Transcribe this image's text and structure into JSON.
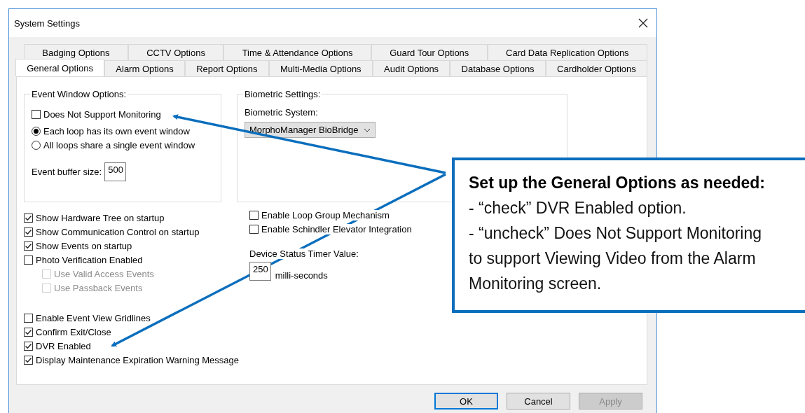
{
  "window": {
    "title": "System Settings"
  },
  "tab_rows": [
    {
      "tabs": [
        {
          "label": "Badging Options",
          "selected": false
        },
        {
          "label": "CCTV Options",
          "selected": false
        },
        {
          "label": "Time & Attendance Options",
          "selected": false
        },
        {
          "label": "Guard Tour Options",
          "selected": false
        },
        {
          "label": "Card Data Replication Options",
          "selected": false
        }
      ]
    },
    {
      "tabs": [
        {
          "label": "General Options",
          "selected": true
        },
        {
          "label": "Alarm Options",
          "selected": false
        },
        {
          "label": "Report Options",
          "selected": false
        },
        {
          "label": "Multi-Media Options",
          "selected": false
        },
        {
          "label": "Audit Options",
          "selected": false
        },
        {
          "label": "Database Options",
          "selected": false
        },
        {
          "label": "Cardholder Options",
          "selected": false
        }
      ]
    }
  ],
  "event_window": {
    "title": "Event Window Options:",
    "monitoring": {
      "label": "Does Not Support Monitoring",
      "checked": false
    },
    "radios": [
      {
        "label": "Each loop has its own event window",
        "selected": true
      },
      {
        "label": "All loops share a single event window",
        "selected": false
      }
    ],
    "buffer_label": "Event buffer size:",
    "buffer_value": "500"
  },
  "biometric": {
    "title": "Biometric Settings:",
    "system_label": "Biometric System:",
    "system_value": "MorphoManager BioBridge"
  },
  "left_options": [
    {
      "label": "Show Hardware Tree on startup",
      "checked": true,
      "disabled": false
    },
    {
      "label": "Show Communication Control on startup",
      "checked": true,
      "disabled": false
    },
    {
      "label": "Show Events on startup",
      "checked": true,
      "disabled": false
    },
    {
      "label": "Photo Verification Enabled",
      "checked": false,
      "disabled": false,
      "children": [
        {
          "label": "Use Valid Access Events",
          "checked": false,
          "disabled": true
        },
        {
          "label": "Use Passback Events",
          "checked": false,
          "disabled": true
        }
      ]
    }
  ],
  "lower_options": [
    {
      "label": "Enable Event View Gridlines",
      "checked": false,
      "disabled": false
    },
    {
      "label": "Confirm Exit/Close",
      "checked": true,
      "disabled": false
    },
    {
      "label": "DVR Enabled",
      "checked": true,
      "disabled": false
    },
    {
      "label": "Display Maintenance Expiration Warning Message",
      "checked": true,
      "disabled": false
    }
  ],
  "right_options": [
    {
      "label": "Enable Loop Group Mechanism",
      "checked": false,
      "disabled": false
    },
    {
      "label": "Enable Schindler Elevator Integration",
      "checked": false,
      "disabled": false
    }
  ],
  "timer": {
    "label": "Device Status Timer Value:",
    "value": "250",
    "unit": "milli-seconds"
  },
  "buttons": [
    {
      "label": "OK",
      "default": true,
      "disabled": false
    },
    {
      "label": "Cancel",
      "default": false,
      "disabled": false
    },
    {
      "label": "Apply",
      "default": false,
      "disabled": true
    }
  ],
  "callout": {
    "title": "Set up the General Options as needed:",
    "items": [
      "- “check” DVR Enabled option.",
      "- “uncheck” Does Not Support Monitoring to support Viewing Video from the Alarm Monitoring screen."
    ]
  }
}
